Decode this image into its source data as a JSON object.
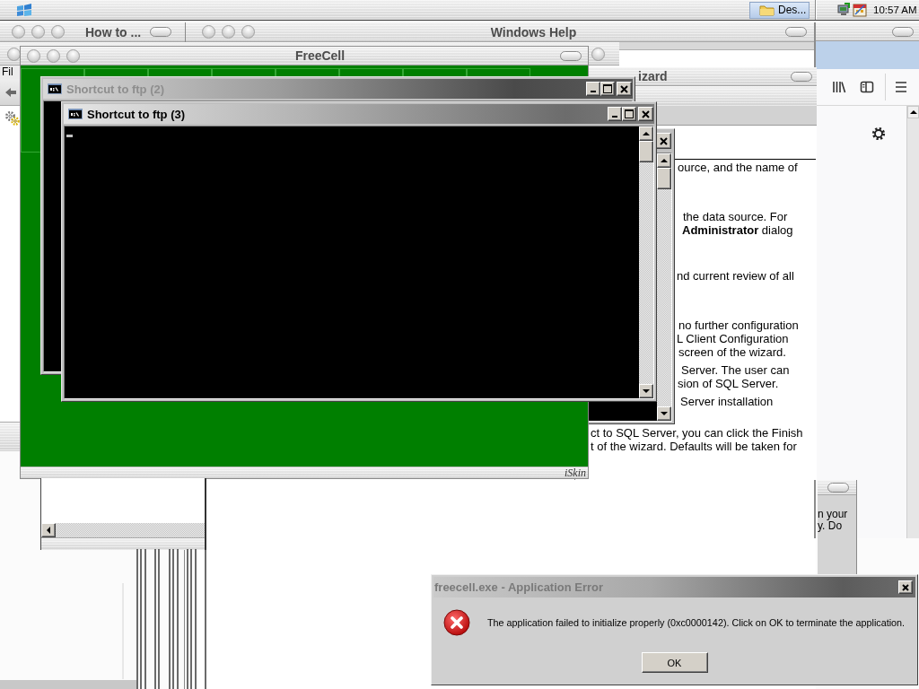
{
  "taskbar": {
    "tasks": [
      {
        "label": "Des...",
        "selected": true
      }
    ],
    "clock": "10:57 AM"
  },
  "how_to_window": {
    "title": "How to ...",
    "menu": [
      "Fil"
    ]
  },
  "help_window": {
    "title": "Windows Help"
  },
  "wizard_window": {
    "title": "izard",
    "lines": [
      "ource, and the name of",
      "the data source. For",
      "**Administrator** dialog",
      "nd current review of all",
      "no further configuration",
      "L Client Configuration",
      "screen of the wizard.",
      "Server. The user can",
      "sion of SQL Server.",
      "Server installation",
      "ct to SQL Server, you can click the Finish",
      "t of the wizard. Defaults will be taken for"
    ]
  },
  "side_window": {
    "lines": [
      "n your",
      "y. Do"
    ]
  },
  "freecell_window": {
    "title": "FreeCell",
    "brand": "iSkin"
  },
  "consoles": [
    {
      "title": "Shortcut to ftp (2)",
      "active": false
    },
    {
      "title": "Shortcut to ftp (3)",
      "active": true
    }
  ],
  "error_dialog": {
    "title": "freecell.exe - Application Error",
    "message": "The application failed to initialize properly (0xc0000142). Click on OK to terminate the application.",
    "buttons": [
      "OK"
    ]
  }
}
